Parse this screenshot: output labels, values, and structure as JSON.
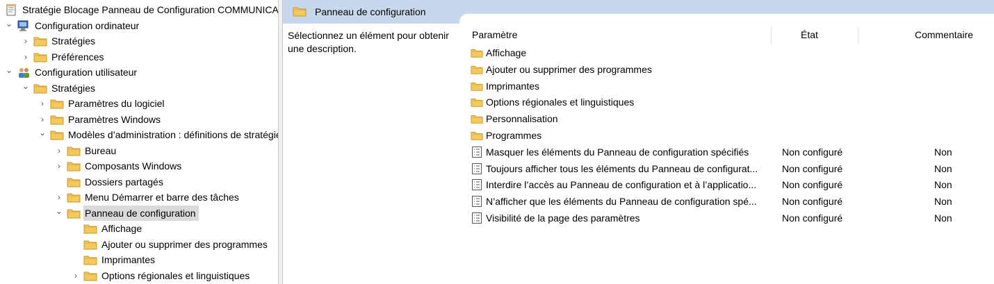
{
  "tree": {
    "items": [
      {
        "label": "Stratégie Blocage Panneau de Configuration COMMUNICATION",
        "icon": "policy-document-icon",
        "chevron": "",
        "level": 0
      },
      {
        "label": "Configuration ordinateur",
        "icon": "computer-icon",
        "chevron": "expanded",
        "level": 0
      },
      {
        "label": "Stratégies",
        "icon": "folder-icon",
        "chevron": "collapsed",
        "level": 1
      },
      {
        "label": "Préférences",
        "icon": "folder-icon",
        "chevron": "collapsed",
        "level": 1
      },
      {
        "label": "Configuration utilisateur",
        "icon": "users-icon",
        "chevron": "expanded",
        "level": 0
      },
      {
        "label": "Stratégies",
        "icon": "folder-icon",
        "chevron": "expanded",
        "level": 1
      },
      {
        "label": "Paramètres du logiciel",
        "icon": "folder-icon",
        "chevron": "collapsed",
        "level": 2
      },
      {
        "label": "Paramètres Windows",
        "icon": "folder-icon",
        "chevron": "collapsed",
        "level": 2
      },
      {
        "label": "Modèles d’administration : définitions de stratégies",
        "icon": "folder-icon",
        "chevron": "expanded",
        "level": 2
      },
      {
        "label": "Bureau",
        "icon": "folder-icon",
        "chevron": "collapsed",
        "level": 3
      },
      {
        "label": "Composants Windows",
        "icon": "folder-icon",
        "chevron": "collapsed",
        "level": 3
      },
      {
        "label": "Dossiers partagés",
        "icon": "folder-icon",
        "chevron": "",
        "level": 3
      },
      {
        "label": "Menu Démarrer et barre des tâches",
        "icon": "folder-icon",
        "chevron": "collapsed",
        "level": 3
      },
      {
        "label": "Panneau de configuration",
        "icon": "folder-icon",
        "chevron": "expanded",
        "level": 3,
        "selected": true
      },
      {
        "label": "Affichage",
        "icon": "folder-icon",
        "chevron": "",
        "level": 4
      },
      {
        "label": "Ajouter ou supprimer des programmes",
        "icon": "folder-icon",
        "chevron": "",
        "level": 4
      },
      {
        "label": "Imprimantes",
        "icon": "folder-icon",
        "chevron": "",
        "level": 4
      },
      {
        "label": "Options régionales et linguistiques",
        "icon": "folder-icon",
        "chevron": "collapsed",
        "level": 4
      }
    ]
  },
  "panel": {
    "title": "Panneau de configuration",
    "description": "Sélectionnez un élément pour obtenir une description."
  },
  "list": {
    "columns": {
      "name": "Paramètre",
      "state": "État",
      "comment": "Commentaire"
    },
    "rows": [
      {
        "name": "Affichage",
        "type": "folder",
        "state": "",
        "comment": ""
      },
      {
        "name": "Ajouter ou supprimer des programmes",
        "type": "folder",
        "state": "",
        "comment": ""
      },
      {
        "name": "Imprimantes",
        "type": "folder",
        "state": "",
        "comment": ""
      },
      {
        "name": "Options régionales et linguistiques",
        "type": "folder",
        "state": "",
        "comment": ""
      },
      {
        "name": "Personnalisation",
        "type": "folder",
        "state": "",
        "comment": ""
      },
      {
        "name": "Programmes",
        "type": "folder",
        "state": "",
        "comment": ""
      },
      {
        "name": "Masquer les éléments du Panneau de configuration spécifiés",
        "type": "setting",
        "state": "Non configuré",
        "comment": "Non"
      },
      {
        "name": "Toujours afficher tous les éléments du Panneau de configurat...",
        "type": "setting",
        "state": "Non configuré",
        "comment": "Non"
      },
      {
        "name": "Interdire l’accès au Panneau de configuration et à l’applicatio...",
        "type": "setting",
        "state": "Non configuré",
        "comment": "Non"
      },
      {
        "name": "N’afficher que les éléments du Panneau de configuration spé...",
        "type": "setting",
        "state": "Non configuré",
        "comment": "Non"
      },
      {
        "name": "Visibilité de la page des paramètres",
        "type": "setting",
        "state": "Non configuré",
        "comment": "Non"
      }
    ]
  },
  "colors": {
    "header_bg": "#c8d8ec",
    "selected_bg": "#dadada",
    "folder": "#f3c95c"
  }
}
